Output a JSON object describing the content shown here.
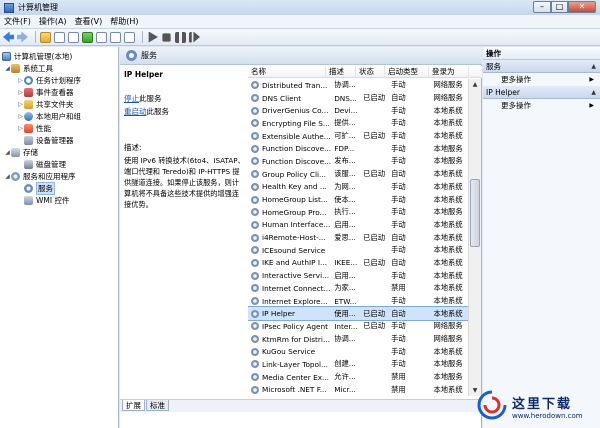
{
  "window": {
    "title": "计算机管理",
    "min": "–",
    "max": "□",
    "close": "✕"
  },
  "menu": [
    "文件(F)",
    "操作(A)",
    "查看(V)",
    "帮助(H)"
  ],
  "tree": {
    "root": "计算机管理(本地)",
    "system_tools": "系统工具",
    "task_scheduler": "任务计划程序",
    "event_viewer": "事件查看器",
    "shared_folders": "共享文件夹",
    "local_users": "本地用户和组",
    "performance": "性能",
    "device_manager": "设备管理器",
    "storage": "存储",
    "disk_mgmt": "磁盘管理",
    "services_apps": "服务和应用程序",
    "services": "服务",
    "wmi": "WMI 控件"
  },
  "middle": {
    "header": "服务",
    "detail": {
      "name": "IP Helper",
      "stop_link": "停止",
      "stop_suffix": "此服务",
      "restart_link": "重启动",
      "restart_suffix": "此服务",
      "desc_label": "描述:",
      "desc_text": "使用 IPv6 转换技术(6to4、ISATAP、端口代理和 Teredo)和 IP-HTTPS 提供隧道连接。如果停止该服务，则计算机将不具备这些技术提供的增强连接优势。"
    },
    "columns": {
      "name": "名称",
      "desc": "描述",
      "status": "状态",
      "startup": "启动类型",
      "logon": "登录为"
    },
    "rows": [
      {
        "name": "Distributed Tran...",
        "desc": "协调...",
        "status": "",
        "startup": "手动",
        "logon": "网络服务"
      },
      {
        "name": "DNS Client",
        "desc": "DNS...",
        "status": "已启动",
        "startup": "自动",
        "logon": "网络服务"
      },
      {
        "name": "DriverGenius Co...",
        "desc": "Devi...",
        "status": "",
        "startup": "手动",
        "logon": "本地系统"
      },
      {
        "name": "Encrypting File S...",
        "desc": "提供...",
        "status": "",
        "startup": "手动",
        "logon": "本地系统"
      },
      {
        "name": "Extensible Authe...",
        "desc": "可扩...",
        "status": "已启动",
        "startup": "手动",
        "logon": "本地系统"
      },
      {
        "name": "Function Discove...",
        "desc": "FDP...",
        "status": "",
        "startup": "手动",
        "logon": "本地服务"
      },
      {
        "name": "Function Discove...",
        "desc": "发布...",
        "status": "",
        "startup": "手动",
        "logon": "本地服务"
      },
      {
        "name": "Group Policy Cli...",
        "desc": "该服...",
        "status": "已启动",
        "startup": "自动",
        "logon": "本地系统"
      },
      {
        "name": "Health Key and ...",
        "desc": "为网...",
        "status": "",
        "startup": "手动",
        "logon": "本地系统"
      },
      {
        "name": "HomeGroup List...",
        "desc": "使本...",
        "status": "",
        "startup": "手动",
        "logon": "本地系统"
      },
      {
        "name": "HomeGroup Pro...",
        "desc": "执行...",
        "status": "",
        "startup": "手动",
        "logon": "本地服务"
      },
      {
        "name": "Human Interface...",
        "desc": "启用...",
        "status": "",
        "startup": "手动",
        "logon": "本地系统"
      },
      {
        "name": "i4Remote-Host-...",
        "desc": "爱思...",
        "status": "已启动",
        "startup": "自动",
        "logon": "本地系统"
      },
      {
        "name": "ICEsound Service",
        "desc": "",
        "status": "",
        "startup": "手动",
        "logon": "本地系统"
      },
      {
        "name": "IKE and AuthIP I...",
        "desc": "IKEE...",
        "status": "已启动",
        "startup": "自动",
        "logon": "本地系统"
      },
      {
        "name": "Interactive Servi...",
        "desc": "启用...",
        "status": "",
        "startup": "手动",
        "logon": "本地系统"
      },
      {
        "name": "Internet Connect...",
        "desc": "为家...",
        "status": "",
        "startup": "禁用",
        "logon": "本地系统"
      },
      {
        "name": "Internet Explore...",
        "desc": "ETW...",
        "status": "",
        "startup": "手动",
        "logon": "本地系统"
      },
      {
        "name": "IP Helper",
        "desc": "使用...",
        "status": "已启动",
        "startup": "自动",
        "logon": "本地系统"
      },
      {
        "name": "IPsec Policy Agent",
        "desc": "Inter...",
        "status": "已启动",
        "startup": "手动",
        "logon": "网络服务"
      },
      {
        "name": "KtmRm for Distri...",
        "desc": "协调...",
        "status": "",
        "startup": "手动",
        "logon": "网络服务"
      },
      {
        "name": "KuGou Service",
        "desc": "",
        "status": "",
        "startup": "手动",
        "logon": "本地系统"
      },
      {
        "name": "Link-Layer Topol...",
        "desc": "创建...",
        "status": "",
        "startup": "手动",
        "logon": "本地服务"
      },
      {
        "name": "Media Center Ex...",
        "desc": "允许...",
        "status": "",
        "startup": "禁用",
        "logon": "本地服务"
      },
      {
        "name": "Microsoft .NET F...",
        "desc": "Micr...",
        "status": "",
        "startup": "禁用",
        "logon": "本地系统"
      }
    ],
    "highlight_row": 18,
    "tabs": [
      "扩展",
      "标准"
    ]
  },
  "actions": {
    "header": "操作",
    "section1": "服务",
    "more1": "更多操作",
    "section2": "IP Helper",
    "more2": "更多操作"
  },
  "watermark": {
    "title": "这里下载",
    "url": "www.herodown.com"
  }
}
